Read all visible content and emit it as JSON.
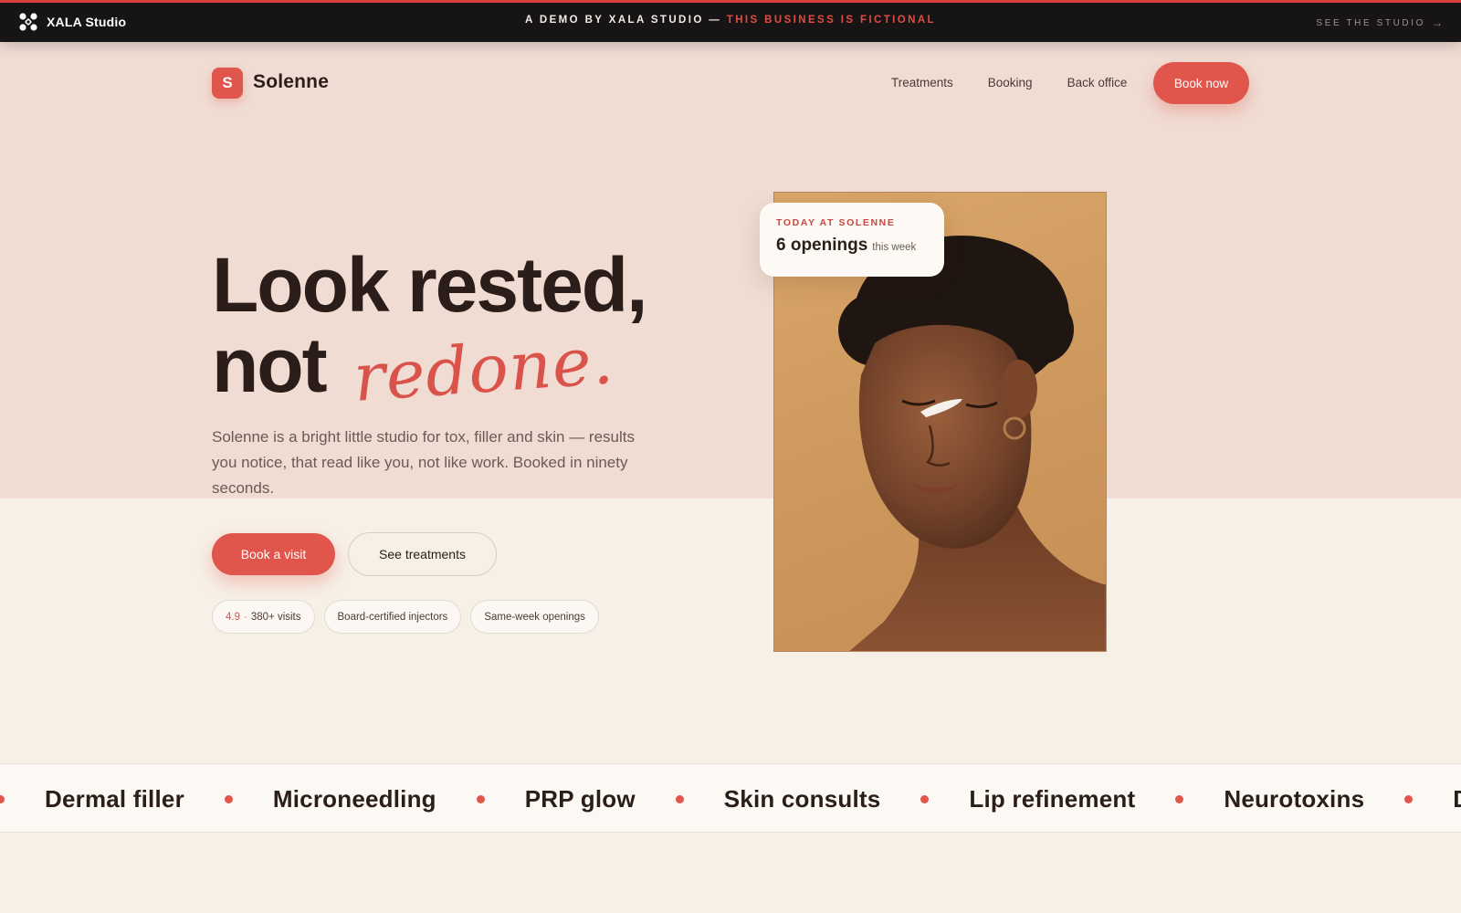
{
  "demo_bar": {
    "brand_name": "XALA Studio",
    "prefix": "A DEMO BY XALA STUDIO — ",
    "accent_text": "THIS BUSINESS IS FICTIONAL",
    "right_link": "SEE THE STUDIO",
    "right_icon": "arrow-right-icon"
  },
  "nav": {
    "logo_letter": "S",
    "brand": "Solenne",
    "links": [
      "Treatments",
      "Booking",
      "Back office"
    ],
    "cta": "Book now"
  },
  "hero": {
    "headline_line1": "Look rested,",
    "headline_line2_plain": "not",
    "headline_line2_script": "redone.",
    "lead": "Solenne is a bright little studio for tox, filler and skin — results you notice, that read like you, not like work. Booked in ninety seconds.",
    "primary_cta": "Book a visit",
    "secondary_cta": "See treatments",
    "chips": {
      "rating": "4.9",
      "visits": "380+ visits",
      "injectors": "Board-certified injectors",
      "openings": "Same-week openings"
    }
  },
  "openings_card": {
    "eyebrow": "TODAY AT SOLENNE",
    "count": "6 openings",
    "note": "this week"
  },
  "marquee": {
    "items": [
      "Dermal filler",
      "Microneedling",
      "PRP glow",
      "Skin consults",
      "Lip refinement",
      "Neurotoxins",
      "D"
    ]
  },
  "colors": {
    "accent": "#e0564c",
    "hero_band": "#f0dcd3",
    "page_bg": "#f7f0e7",
    "ink": "#2b1d19",
    "demo_bar": "#161414"
  }
}
